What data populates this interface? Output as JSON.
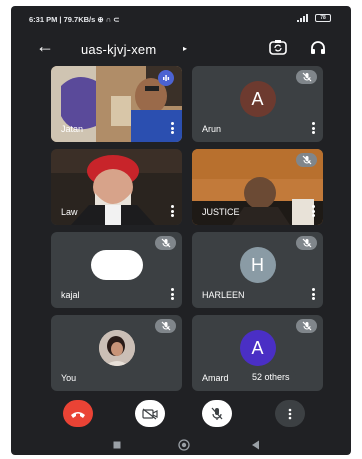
{
  "status_bar": {
    "left_text": "6:31 PM | 79.7KB/s ⊕ ∩ ⊂",
    "battery": "78"
  },
  "top_bar": {
    "back_icon": "arrow-left-icon",
    "meeting_code": "uas-kjvj-xem",
    "meeting_caret": "▸"
  },
  "participants": [
    {
      "name": "Jatan",
      "kind": "video",
      "active_speaker": true
    },
    {
      "name": "Arun",
      "kind": "avatar",
      "initial": "A",
      "avatar_color": "#6d3a2f",
      "muted": true
    },
    {
      "name": "Law",
      "kind": "video",
      "muted": false
    },
    {
      "name": "JUSTICE",
      "kind": "video",
      "muted": true
    },
    {
      "name": "kajal",
      "kind": "avatar-photo",
      "muted": true
    },
    {
      "name": "HARLEEN",
      "kind": "avatar",
      "initial": "H",
      "avatar_color": "#8a9ba5",
      "muted": true
    },
    {
      "name": "You",
      "kind": "avatar-photo",
      "muted": true
    },
    {
      "name": "Amard",
      "kind": "avatar",
      "initial": "A",
      "avatar_color": "#4a2fc5",
      "muted": true,
      "others_label": "52 others"
    }
  ],
  "controls": {
    "end_call_color": "#ea4335",
    "items": [
      "end-call-icon",
      "camera-off-icon",
      "mic-off-icon",
      "more-options-icon"
    ]
  },
  "nav_bar": {
    "items": [
      "recents-icon",
      "home-icon",
      "back-nav-icon"
    ]
  }
}
